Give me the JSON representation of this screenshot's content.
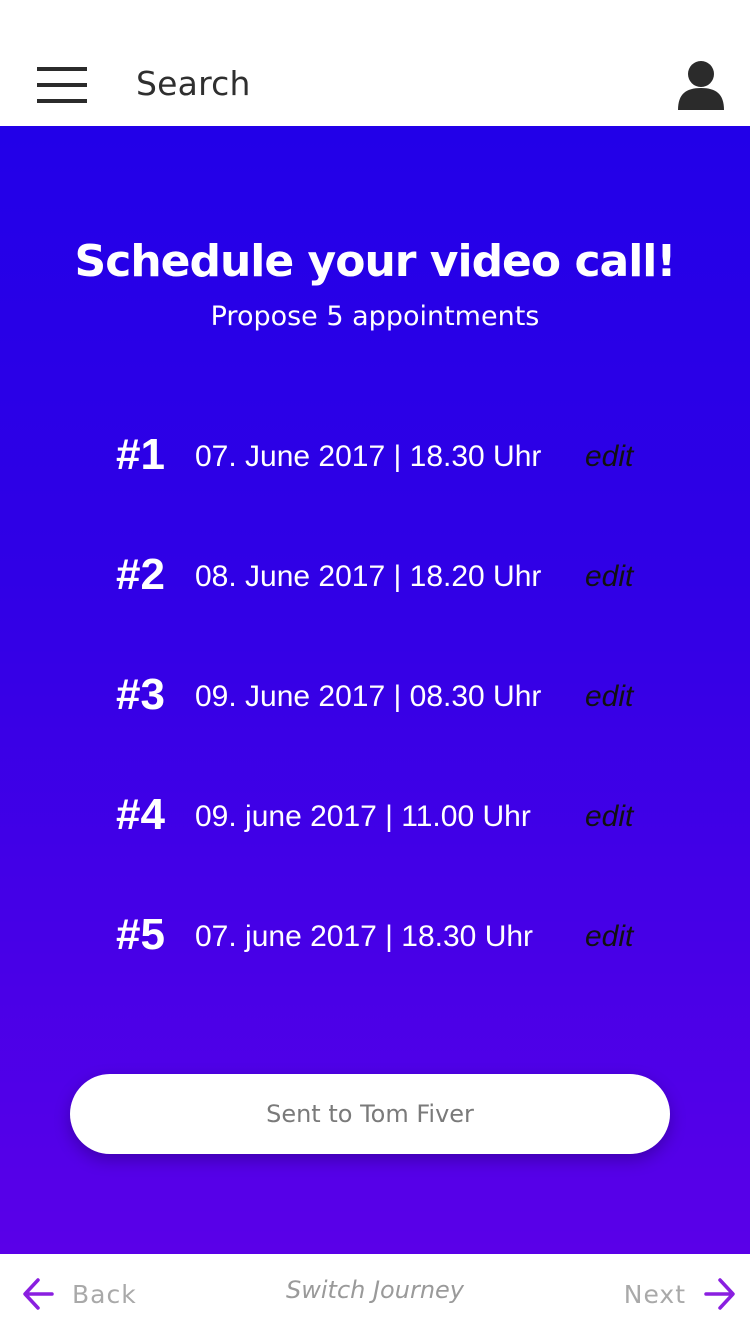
{
  "header": {
    "search_label": "Search",
    "menu_icon": "hamburger-menu-icon",
    "profile_icon": "user-avatar-icon"
  },
  "main": {
    "title": "Schedule your video call!",
    "subtitle": "Propose 5  appointments",
    "appointments": [
      {
        "number": "#1",
        "datetime": "07. June 2017 | 18.30 Uhr",
        "edit_label": "edit"
      },
      {
        "number": "#2",
        "datetime": "08. June 2017 | 18.20 Uhr",
        "edit_label": "edit"
      },
      {
        "number": "#3",
        "datetime": "09. June 2017 | 08.30 Uhr",
        "edit_label": "edit"
      },
      {
        "number": "#4",
        "datetime": "09. june 2017 | 11.00 Uhr",
        "edit_label": "edit"
      },
      {
        "number": "#5",
        "datetime": "07. june 2017 | 18.30 Uhr",
        "edit_label": "edit"
      }
    ],
    "send_button_label": "Sent to Tom Fiver"
  },
  "footer": {
    "back_label": "Back",
    "switch_label": "Switch Journey",
    "next_label": "Next"
  },
  "colors": {
    "gradient_top": "#2200e8",
    "gradient_bottom": "#5a00e8",
    "accent_arrow": "#8a1fe0",
    "white": "#ffffff"
  }
}
